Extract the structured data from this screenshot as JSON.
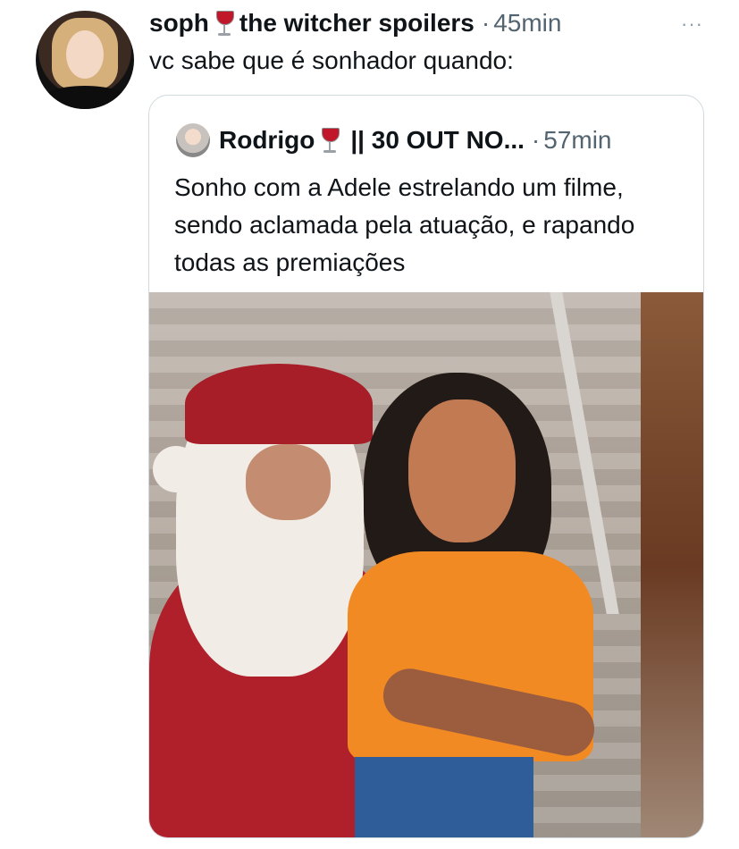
{
  "tweet": {
    "display_name": "soph",
    "name_suffix": "the witcher spoilers",
    "separator": "·",
    "time": "45min",
    "more_icon": "···",
    "text": "vc sabe que é sonhador quando:"
  },
  "quoted_tweet": {
    "display_name": "Rodrigo",
    "name_suffix": "|| 30 OUT NO...",
    "separator": "·",
    "time": "57min",
    "text": "Sonho com a Adele estrelando um filme, sendo aclamada pela atuação, e rapando todas as premiações"
  },
  "icons": {
    "wine": "wine-glass-emoji",
    "more": "more-options-icon"
  },
  "colors": {
    "text_primary": "#0f1419",
    "text_secondary": "#536471",
    "border": "#cfd9de"
  }
}
